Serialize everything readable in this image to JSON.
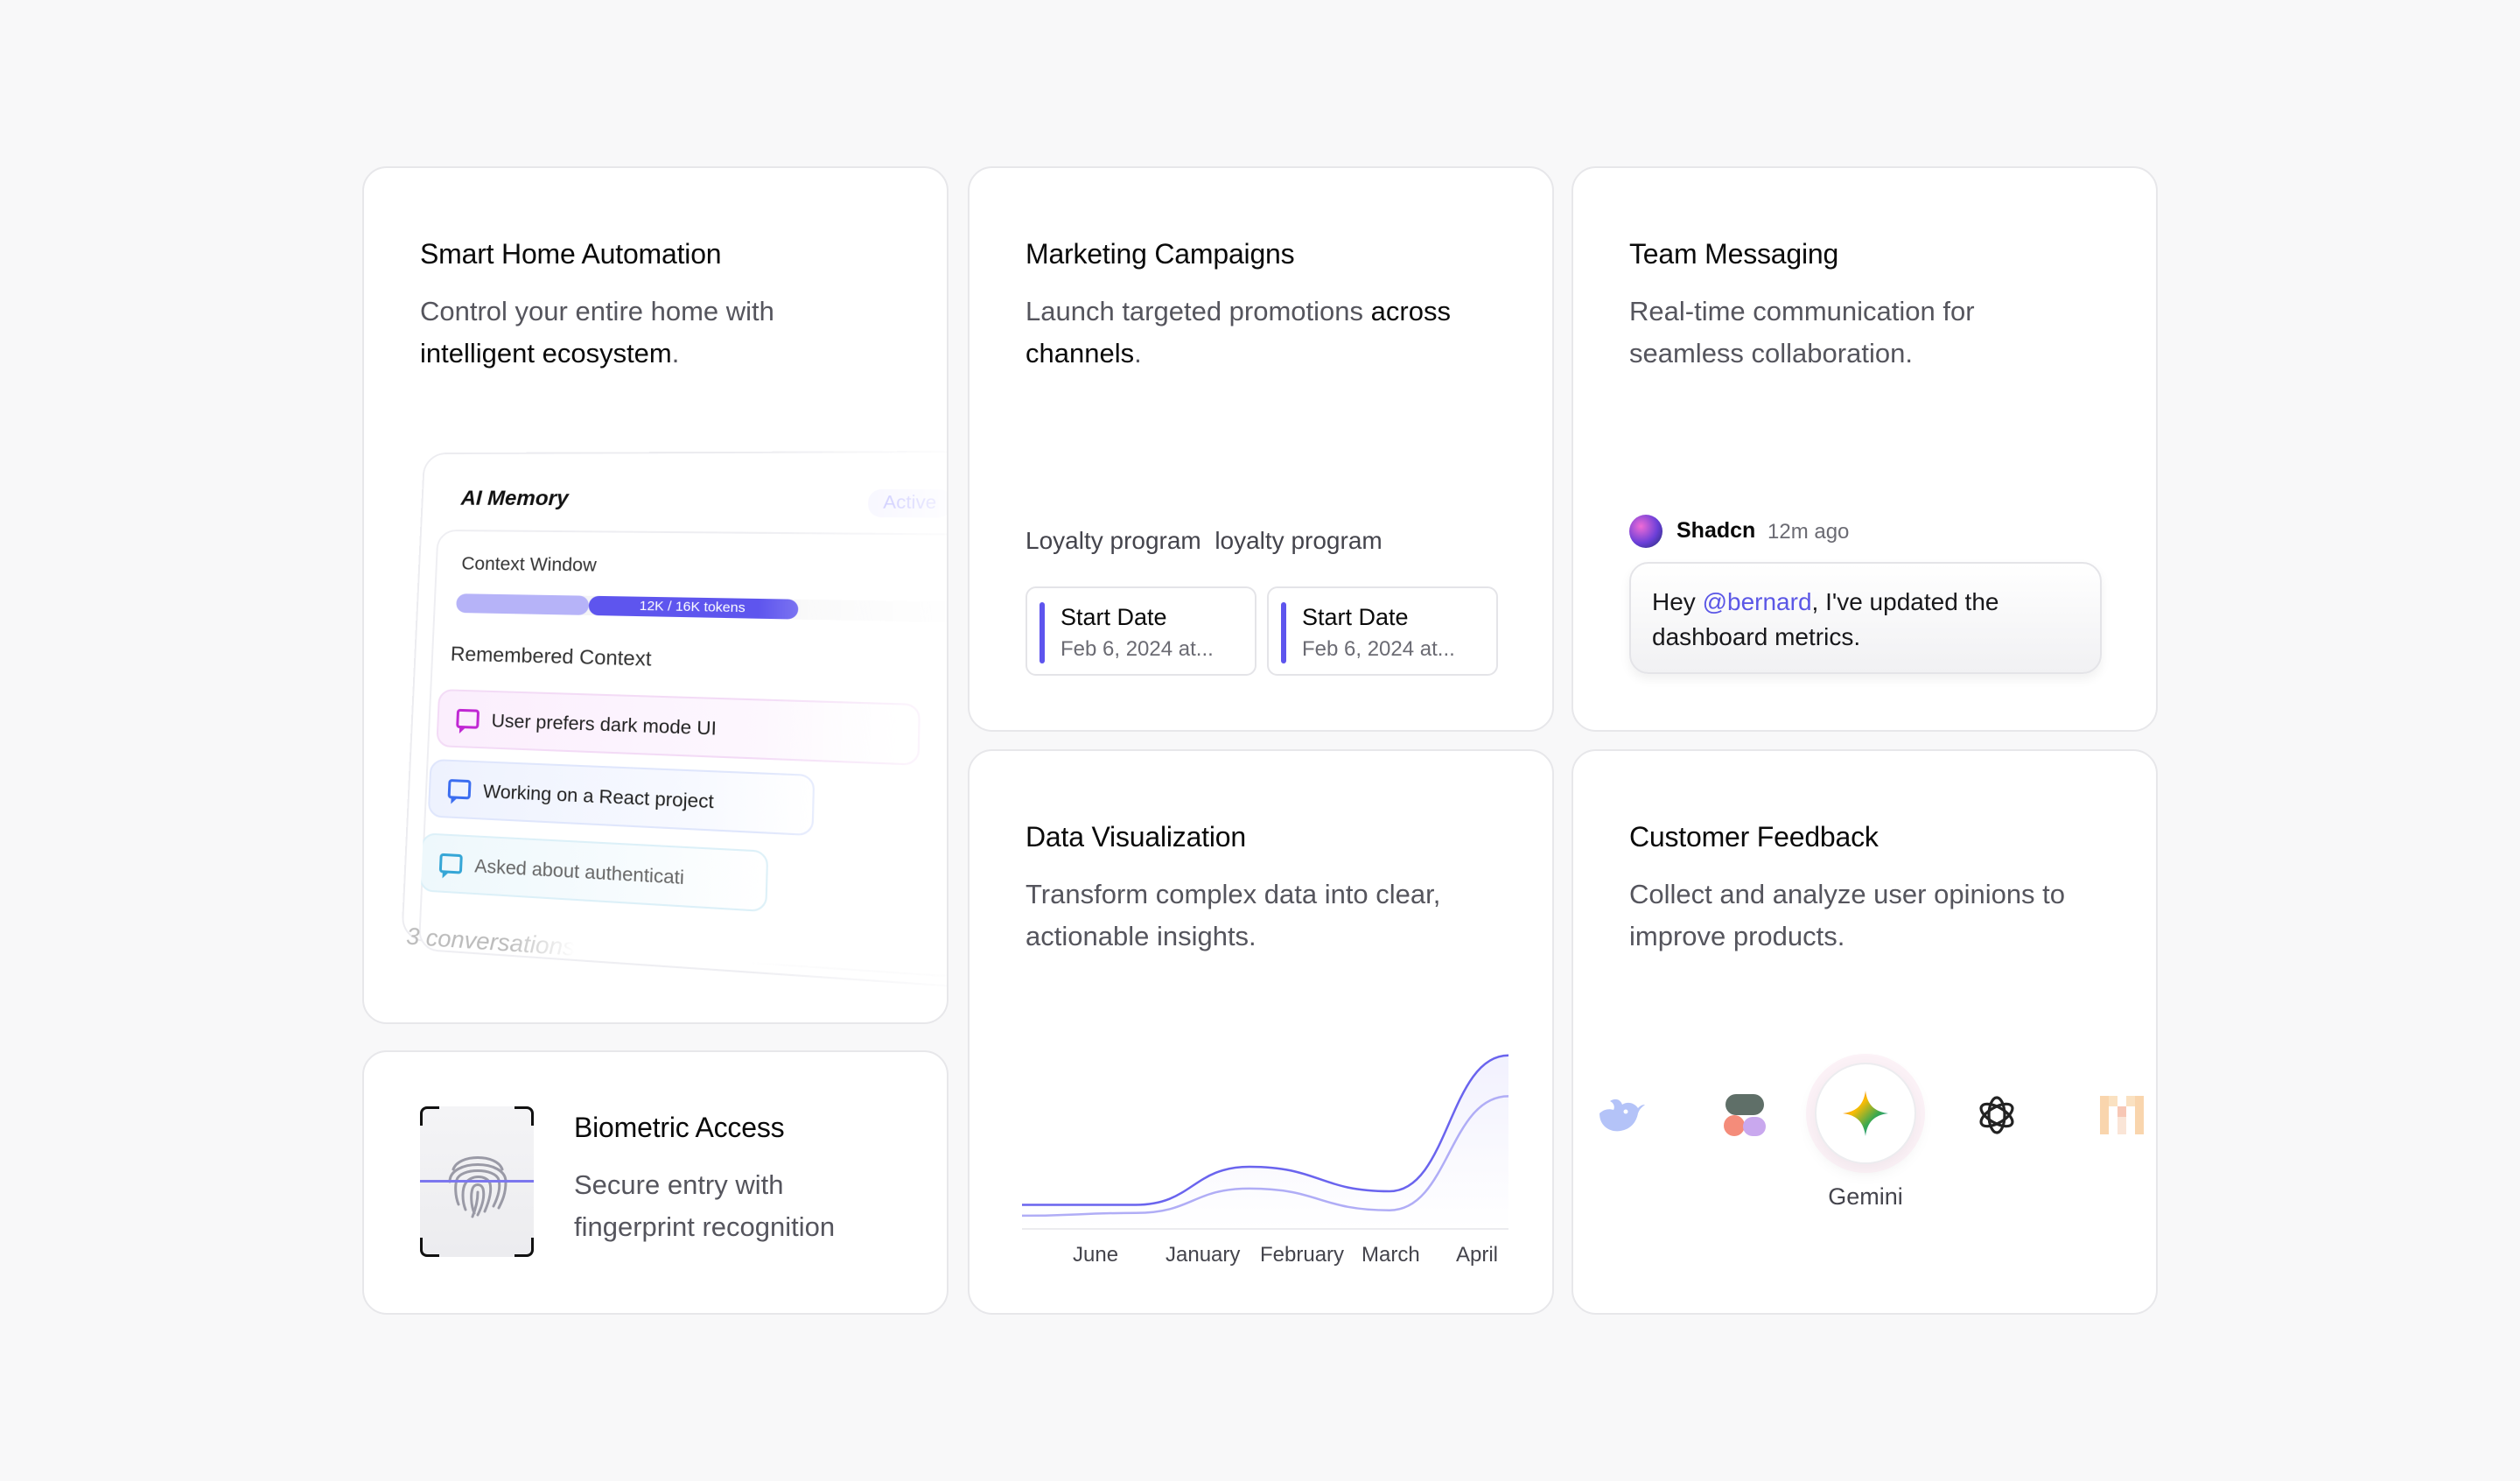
{
  "smart_home": {
    "title": "Smart Home Automation",
    "desc_plain": "Control your entire home with",
    "desc_bold": "intelligent ecosystem",
    "desc_end": ".",
    "memory": {
      "title": "AI Memory",
      "badge": "Active",
      "context_label": "Context Window",
      "tokens": "12K / 16K tokens",
      "remembered_label": "Remembered Context",
      "items": [
        "User prefers dark mode UI",
        "Working on a React project",
        "Asked about authenticati"
      ],
      "footer": "3 conversations"
    }
  },
  "biometric": {
    "title": "Biometric Access",
    "desc_line1": "Secure entry with",
    "desc_line2": "fingerprint recognition"
  },
  "marketing": {
    "title": "Marketing Campaigns",
    "desc_plain": "Launch targeted promotions",
    "desc_bold": "across channels",
    "desc_end": ".",
    "loyalty_text": "Loyalty program  loyalty program",
    "dates": [
      {
        "title": "Start Date",
        "date": "Feb 6, 2024 at..."
      },
      {
        "title": "Start Date",
        "date": "Feb 6, 2024 at..."
      }
    ]
  },
  "team": {
    "title": "Team Messaging",
    "desc_line1": "Real-time communication for",
    "desc_line2": "seamless collaboration.",
    "message": {
      "user": "Shadcn",
      "time": "12m ago",
      "pre": "Hey ",
      "mention": "@bernard",
      "post": ", I've updated the dashboard metrics."
    }
  },
  "data_viz": {
    "title": "Data Visualization",
    "desc_line1": "Transform complex data into clear,",
    "desc_line2": "actionable insights."
  },
  "chart_data": {
    "type": "line",
    "categories": [
      "June",
      "January",
      "February",
      "March",
      "April"
    ],
    "series": [
      {
        "values": [
          10,
          10,
          38,
          20,
          120
        ]
      },
      {
        "values": [
          2,
          4,
          22,
          6,
          90
        ]
      }
    ],
    "title": "",
    "xlabel": "",
    "ylabel": "",
    "grid": false,
    "colors": [
      "#6a64ee",
      "#b0adf6"
    ]
  },
  "customer": {
    "title": "Customer Feedback",
    "desc_line1": "Collect and analyze user opinions to",
    "desc_line2": "improve products.",
    "logos": [
      "deepseek-icon",
      "shapes-icon",
      "gemini-icon",
      "openai-icon",
      "mistral-icon"
    ],
    "selected_label": "Gemini"
  },
  "colors": {
    "accent": "#5e55ee",
    "background": "#f8f8f9",
    "card": "#ffffff"
  }
}
